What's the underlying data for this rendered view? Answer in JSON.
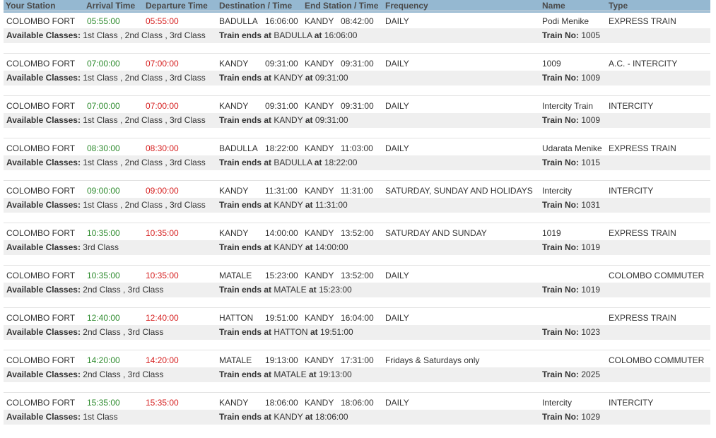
{
  "headers": [
    "Your Station",
    "Arrival Time",
    "Departure Time",
    "Destination / Time",
    "End Station / Time",
    "Frequency",
    "Name",
    "Type"
  ],
  "labels": {
    "available_classes": "Available Classes:",
    "train_ends_at": "Train ends at",
    "at": "at",
    "train_no": "Train No:"
  },
  "trains": [
    {
      "station": "COLOMBO FORT",
      "arrival": "05:55:00",
      "departure": "05:55:00",
      "dest": "BADULLA",
      "dest_time": "16:06:00",
      "end": "KANDY",
      "end_time": "08:42:00",
      "frequency": "DAILY",
      "name": "Podi Menike",
      "type": "EXPRESS TRAIN",
      "classes": "1st Class ,  2nd Class ,  3rd Class",
      "ends_station": "BADULLA",
      "ends_time": "16:06:00",
      "train_no": "1005"
    },
    {
      "station": "COLOMBO FORT",
      "arrival": "07:00:00",
      "departure": "07:00:00",
      "dest": "KANDY",
      "dest_time": "09:31:00",
      "end": "KANDY",
      "end_time": "09:31:00",
      "frequency": "DAILY",
      "name": "1009",
      "type": "A.C. - INTERCITY",
      "classes": "1st Class ,  2nd Class ,  3rd Class",
      "ends_station": "KANDY",
      "ends_time": "09:31:00",
      "train_no": "1009"
    },
    {
      "station": "COLOMBO FORT",
      "arrival": "07:00:00",
      "departure": "07:00:00",
      "dest": "KANDY",
      "dest_time": "09:31:00",
      "end": "KANDY",
      "end_time": "09:31:00",
      "frequency": "DAILY",
      "name": "Intercity Train",
      "type": "INTERCITY",
      "classes": "1st Class ,  2nd Class ,  3rd Class",
      "ends_station": "KANDY",
      "ends_time": "09:31:00",
      "train_no": "1009"
    },
    {
      "station": "COLOMBO FORT",
      "arrival": "08:30:00",
      "departure": "08:30:00",
      "dest": "BADULLA",
      "dest_time": "18:22:00",
      "end": "KANDY",
      "end_time": "11:03:00",
      "frequency": "DAILY",
      "name": "Udarata Menike",
      "type": "EXPRESS TRAIN",
      "classes": "1st Class ,  2nd Class ,  3rd Class",
      "ends_station": "BADULLA",
      "ends_time": "18:22:00",
      "train_no": "1015"
    },
    {
      "station": "COLOMBO FORT",
      "arrival": "09:00:00",
      "departure": "09:00:00",
      "dest": "KANDY",
      "dest_time": "11:31:00",
      "end": "KANDY",
      "end_time": "11:31:00",
      "frequency": "SATURDAY, SUNDAY AND HOLIDAYS",
      "name": "Intercity",
      "type": "INTERCITY",
      "classes": "1st Class ,  2nd Class ,  3rd Class",
      "ends_station": "KANDY",
      "ends_time": "11:31:00",
      "train_no": "1031"
    },
    {
      "station": "COLOMBO FORT",
      "arrival": "10:35:00",
      "departure": "10:35:00",
      "dest": "KANDY",
      "dest_time": "14:00:00",
      "end": "KANDY",
      "end_time": "13:52:00",
      "frequency": "SATURDAY AND SUNDAY",
      "name": "1019",
      "type": "EXPRESS TRAIN",
      "classes": "3rd Class",
      "ends_station": "KANDY",
      "ends_time": "14:00:00",
      "train_no": "1019"
    },
    {
      "station": "COLOMBO FORT",
      "arrival": "10:35:00",
      "departure": "10:35:00",
      "dest": "MATALE",
      "dest_time": "15:23:00",
      "end": "KANDY",
      "end_time": "13:52:00",
      "frequency": "DAILY",
      "name": "",
      "type": "COLOMBO COMMUTER",
      "classes": "2nd Class ,  3rd Class",
      "ends_station": "MATALE",
      "ends_time": "15:23:00",
      "train_no": "1019"
    },
    {
      "station": "COLOMBO FORT",
      "arrival": "12:40:00",
      "departure": "12:40:00",
      "dest": "HATTON",
      "dest_time": "19:51:00",
      "end": "KANDY",
      "end_time": "16:04:00",
      "frequency": "DAILY",
      "name": "",
      "type": "EXPRESS TRAIN",
      "classes": "2nd Class ,  3rd Class",
      "ends_station": "HATTON",
      "ends_time": "19:51:00",
      "train_no": "1023"
    },
    {
      "station": "COLOMBO FORT",
      "arrival": "14:20:00",
      "departure": "14:20:00",
      "dest": "MATALE",
      "dest_time": "19:13:00",
      "end": "KANDY",
      "end_time": "17:31:00",
      "frequency": "Fridays & Saturdays only",
      "name": "",
      "type": "COLOMBO COMMUTER",
      "classes": "2nd Class ,  3rd Class",
      "ends_station": "MATALE",
      "ends_time": "19:13:00",
      "train_no": "2025"
    },
    {
      "station": "COLOMBO FORT",
      "arrival": "15:35:00",
      "departure": "15:35:00",
      "dest": "KANDY",
      "dest_time": "18:06:00",
      "end": "KANDY",
      "end_time": "18:06:00",
      "frequency": "DAILY",
      "name": "Intercity",
      "type": "INTERCITY",
      "classes": "1st Class",
      "ends_station": "KANDY",
      "ends_time": "18:06:00",
      "train_no": "1029"
    }
  ]
}
